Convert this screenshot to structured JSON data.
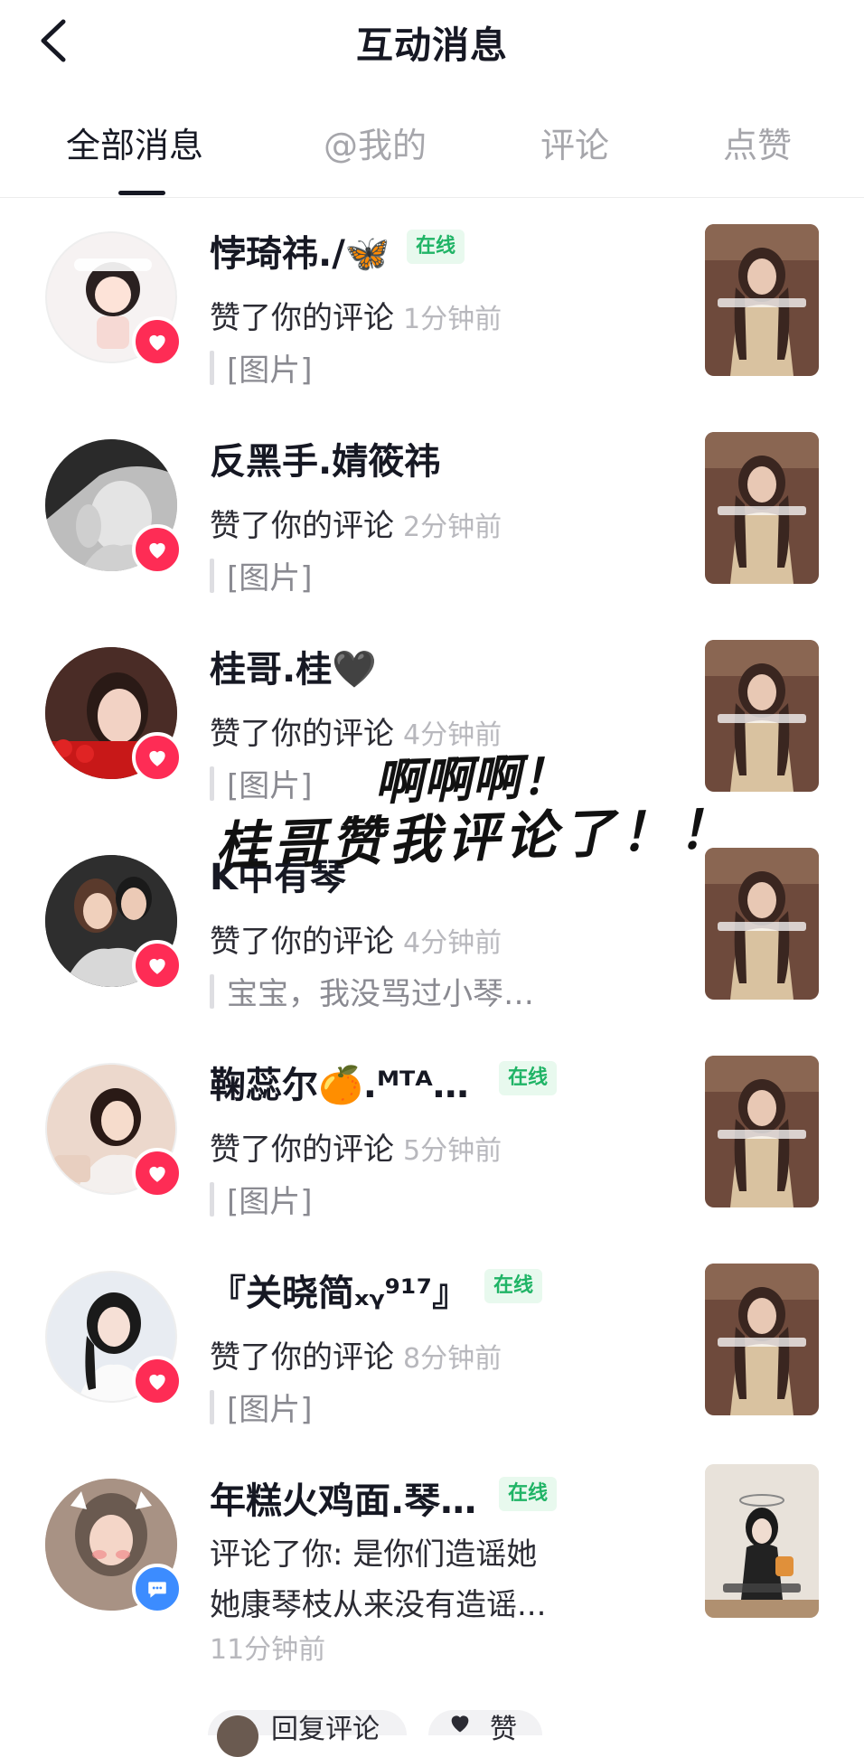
{
  "header": {
    "title": "互动消息",
    "back_icon": "chevron-left-icon"
  },
  "tabs": [
    {
      "label": "全部消息",
      "active": true
    },
    {
      "label": "@我的",
      "active": false
    },
    {
      "label": "评论",
      "active": false
    },
    {
      "label": "点赞",
      "active": false
    }
  ],
  "colors": {
    "like_badge": "#fe2c55",
    "comment_badge": "#3c8cff",
    "online_bg": "#e8f9ee",
    "online_text": "#20b466"
  },
  "notifications": [
    {
      "username": "悖琦祎./🦋",
      "online_label": "在线",
      "action": "赞了你的评论",
      "time": "1分钟前",
      "quote": "[图片]",
      "badge_icon": "heart-icon"
    },
    {
      "username": "反黑手.婧筱祎",
      "action": "赞了你的评论",
      "time": "2分钟前",
      "quote": "[图片]",
      "badge_icon": "heart-icon"
    },
    {
      "username": "桂哥.桂🖤",
      "action": "赞了你的评论",
      "time": "4分钟前",
      "quote": "[图片]",
      "badge_icon": "heart-icon"
    },
    {
      "username": "K中有琴",
      "action": "赞了你的评论",
      "time": "4分钟前",
      "quote": "宝宝，我没骂过小琴…",
      "badge_icon": "heart-icon"
    },
    {
      "username": "鞠蕊尔🍊.ᴹᵀᴬ…",
      "online_label": "在线",
      "action": "赞了你的评论",
      "time": "5分钟前",
      "quote": "[图片]",
      "badge_icon": "heart-icon"
    },
    {
      "username": "『关晓简ₓᵧ⁹¹⁷』",
      "online_label": "在线",
      "action": "赞了你的评论",
      "time": "8分钟前",
      "quote": "[图片]",
      "badge_icon": "heart-icon"
    },
    {
      "username": "年糕火鸡面.琴…",
      "online_label": "在线",
      "comment_line1": "评论了你: 是你们造谣她",
      "comment_line2": "她康琴枝从来没有造谣...",
      "time": "11分钟前",
      "badge_icon": "comment-icon"
    }
  ],
  "overlay_text": {
    "line1": "啊啊啊！",
    "line2": "桂哥赞我评论了！！"
  },
  "actions": {
    "reply_label": "回复评论",
    "like_label": "赞"
  }
}
